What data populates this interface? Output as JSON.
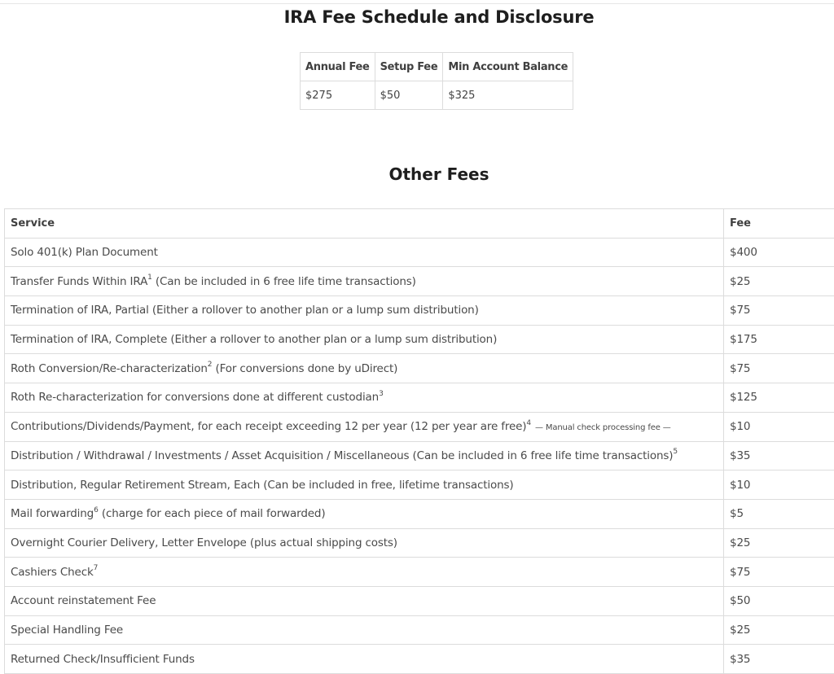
{
  "page_title": "IRA Fee Schedule and Disclosure",
  "summary_table": {
    "headers": [
      "Annual Fee",
      "Setup Fee",
      "Min Account Balance"
    ],
    "values": [
      "$275",
      "$50",
      "$325"
    ]
  },
  "other_fees": {
    "title": "Other Fees",
    "headers": {
      "service": "Service",
      "fee": "Fee"
    },
    "rows": [
      {
        "service": "Solo 401(k) Plan Document",
        "sup": "",
        "rest": "",
        "note": "",
        "fee": "$400"
      },
      {
        "service": "Transfer Funds Within IRA",
        "sup": "1",
        "rest": " (Can be included in 6 free life time transactions)",
        "note": "",
        "fee": "$25"
      },
      {
        "service": "Termination of IRA, Partial (Either a rollover to another plan or a lump sum distribution)",
        "sup": "",
        "rest": "",
        "note": "",
        "fee": "$75"
      },
      {
        "service": "Termination of IRA, Complete (Either a rollover to another plan or a lump sum distribution)",
        "sup": "",
        "rest": "",
        "note": "",
        "fee": "$175"
      },
      {
        "service": "Roth Conversion/Re-characterization",
        "sup": "2",
        "rest": " (For conversions done by uDirect)",
        "note": "",
        "fee": "$75"
      },
      {
        "service": "Roth Re-characterization for conversions done at different custodian",
        "sup": "3",
        "rest": "",
        "note": "",
        "fee": "$125"
      },
      {
        "service": "Contributions/Dividends/Payment, for each receipt exceeding 12 per year (12 per year are free)",
        "sup": "4",
        "rest": "",
        "note": " — Manual check processing fee —",
        "fee": "$10"
      },
      {
        "service": "Distribution / Withdrawal / Investments / Asset Acquisition / Miscellaneous (Can be included in 6 free life time transactions)",
        "sup": "5",
        "rest": "",
        "note": "",
        "fee": "$35"
      },
      {
        "service": "Distribution, Regular Retirement Stream, Each (Can be included in free, lifetime transactions)",
        "sup": "",
        "rest": "",
        "note": "",
        "fee": "$10"
      },
      {
        "service": "Mail forwarding",
        "sup": "6",
        "rest": " (charge for each piece of mail forwarded)",
        "note": "",
        "fee": "$5"
      },
      {
        "service": "Overnight Courier Delivery, Letter Envelope (plus actual shipping costs)",
        "sup": "",
        "rest": "",
        "note": "",
        "fee": "$25"
      },
      {
        "service": "Cashiers Check",
        "sup": "7",
        "rest": "",
        "note": "",
        "fee": "$75"
      },
      {
        "service": "Account reinstatement Fee",
        "sup": "",
        "rest": "",
        "note": "",
        "fee": "$50"
      },
      {
        "service": "Special Handling Fee",
        "sup": "",
        "rest": "",
        "note": "",
        "fee": "$25"
      },
      {
        "service": "Returned Check/Insufficient Funds",
        "sup": "",
        "rest": "",
        "note": "",
        "fee": "$35"
      }
    ]
  }
}
